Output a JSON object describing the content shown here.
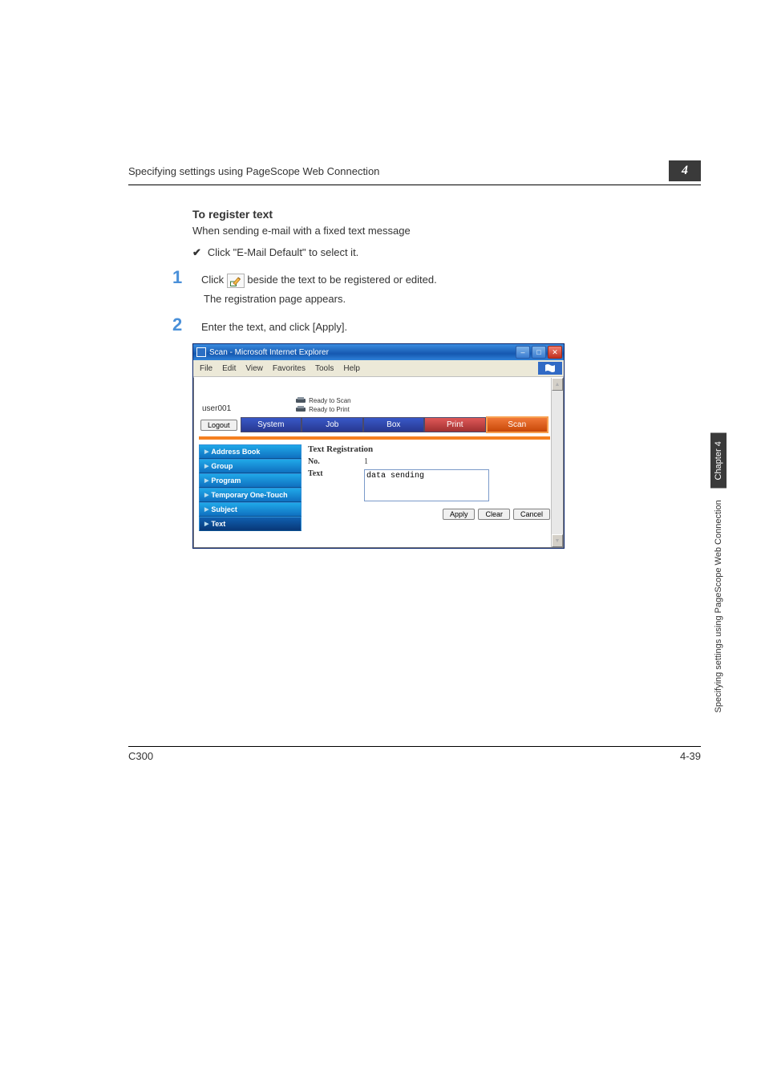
{
  "header": {
    "text": "Specifying settings using PageScope Web Connection",
    "chapter_badge": "4"
  },
  "section": {
    "heading": "To register text",
    "intro": "When sending e-mail with a fixed text message",
    "check_item": "Click \"E-Mail Default\" to select it.",
    "step1_num": "1",
    "step1_text_a": "Click ",
    "step1_text_b": " beside the text to be registered or edited.",
    "step1_sub": "The registration page appears.",
    "step2_num": "2",
    "step2_text": "Enter the text, and click [Apply]."
  },
  "ie": {
    "title": "Scan - Microsoft Internet Explorer",
    "menus": [
      "File",
      "Edit",
      "View",
      "Favorites",
      "Tools",
      "Help"
    ]
  },
  "app": {
    "user": "user001",
    "status1": "Ready to Scan",
    "status2": "Ready to Print",
    "logout": "Logout",
    "tabs": {
      "system": "System",
      "job": "Job",
      "box": "Box",
      "print": "Print",
      "scan": "Scan"
    },
    "sidebar": [
      "Address Book",
      "Group",
      "Program",
      "Temporary One-Touch",
      "Subject",
      "Text"
    ],
    "panel": {
      "title": "Text Registration",
      "no_label": "No.",
      "no_value": "1",
      "text_label": "Text",
      "text_value": "data sending",
      "apply": "Apply",
      "clear": "Clear",
      "cancel": "Cancel"
    }
  },
  "side_tabs": {
    "light": "Specifying settings using PageScope Web Connection",
    "dark": "Chapter 4"
  },
  "footer": {
    "left": "C300",
    "right": "4-39"
  }
}
